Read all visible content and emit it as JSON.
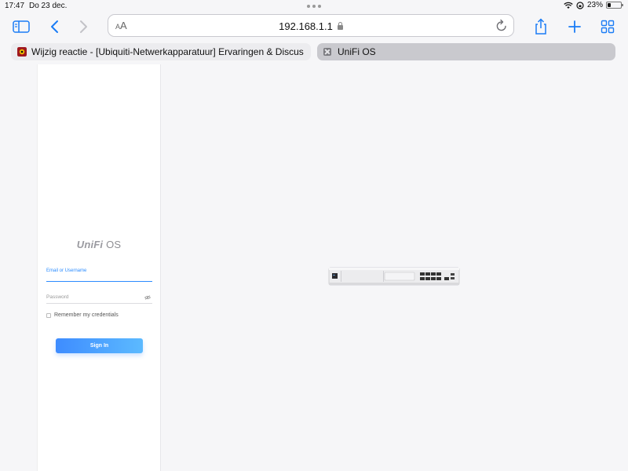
{
  "status_bar": {
    "time": "17:47",
    "date": "Do 23 dec.",
    "battery_text": "23%",
    "battery_level": 0.23
  },
  "toolbar": {
    "aa_label_small": "A",
    "aa_label_large": "A",
    "url": "192.168.1.1",
    "icons": [
      "sidebar-icon",
      "back-icon",
      "forward-icon",
      "text-size-icon",
      "lock-icon",
      "reload-icon",
      "share-icon",
      "new-tab-icon",
      "tab-overview-icon"
    ]
  },
  "tabs": [
    {
      "label": "Wijzig reactie - [Ubiquiti-Netwerkapparatuur] Ervaringen & Discus",
      "active": false
    },
    {
      "label": "UniFi OS",
      "active": true
    }
  ],
  "login": {
    "logo_brand": "UniFi",
    "logo_suffix": "OS",
    "email_label": "Email or Username",
    "password_label": "Password",
    "remember_label": "Remember my credentials",
    "remember_checked": false,
    "signin_label": "Sign In"
  },
  "colors": {
    "accent": "#2b8cff",
    "button_gradient_start": "#3e8cff",
    "button_gradient_end": "#5cbaff",
    "toolbar_icon": "#1a7cf5"
  }
}
